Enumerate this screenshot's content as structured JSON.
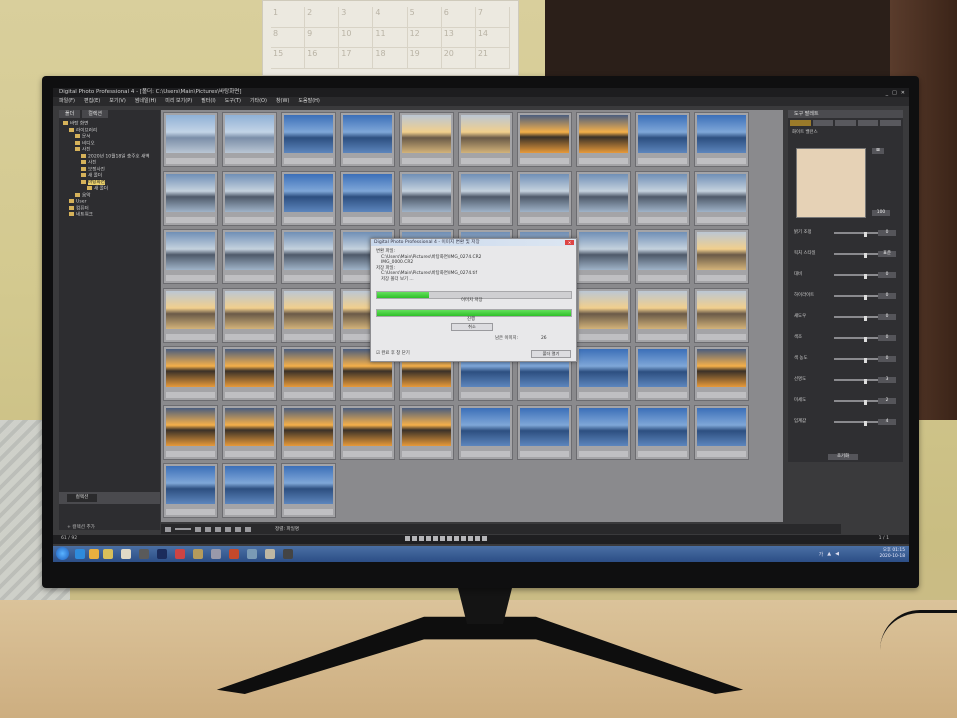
{
  "app": {
    "title": "Digital Photo Professional 4 - [폴더: C:\\Users\\Main\\Pictures\\바탕화면]",
    "window_controls": [
      "_",
      "□",
      "✕"
    ]
  },
  "menu": [
    "파일(F)",
    "편집(E)",
    "보기(V)",
    "썸네일(H)",
    "미리 보기(P)",
    "필터(I)",
    "도구(T)",
    "기타(O)",
    "창(W)",
    "도움말(H)"
  ],
  "left_panel": {
    "tabs": [
      "폴더",
      "컬렉션"
    ],
    "tree": [
      {
        "label": "바탕 화면",
        "depth": 0,
        "selected": false
      },
      {
        "label": "라이브러리",
        "depth": 1,
        "selected": false
      },
      {
        "label": "문서",
        "depth": 2,
        "selected": false
      },
      {
        "label": "비디오",
        "depth": 2,
        "selected": false
      },
      {
        "label": "사진",
        "depth": 2,
        "selected": false
      },
      {
        "label": "2020년 10월18일 충주호 새벽",
        "depth": 3,
        "selected": false
      },
      {
        "label": "사진",
        "depth": 3,
        "selected": false
      },
      {
        "label": "보정사진",
        "depth": 3,
        "selected": false
      },
      {
        "label": "새 폴더",
        "depth": 3,
        "selected": false
      },
      {
        "label": "바탕화면",
        "depth": 3,
        "selected": true
      },
      {
        "label": "새 폴더",
        "depth": 4,
        "selected": false
      },
      {
        "label": "음악",
        "depth": 2,
        "selected": false
      },
      {
        "label": "User",
        "depth": 1,
        "selected": false
      },
      {
        "label": "컴퓨터",
        "depth": 1,
        "selected": false
      },
      {
        "label": "네트워크",
        "depth": 1,
        "selected": false
      }
    ],
    "bottom_tab": "컬렉션",
    "footer": "+ 컬렉션 추가"
  },
  "thumbnails": {
    "rows": [
      [
        "dawn",
        "dawn",
        "blue",
        "blue",
        "gold",
        "gold",
        "sun",
        "sun",
        "blue",
        "blue"
      ],
      [
        "dusk",
        "dusk",
        "blue",
        "blue",
        "dusk",
        "dusk",
        "dusk",
        "dusk",
        "dusk",
        "dusk"
      ],
      [
        "dusk",
        "dusk",
        "dusk",
        "dusk",
        "dusk",
        "dusk",
        "dusk",
        "dusk",
        "dusk",
        "gold"
      ],
      [
        "gold",
        "gold",
        "gold",
        "gold",
        "gold",
        "gold",
        "gold",
        "gold",
        "gold",
        "gold"
      ],
      [
        "sun",
        "sun",
        "sun",
        "sun",
        "sun",
        "blue",
        "blue",
        "blue",
        "blue",
        "sun"
      ],
      [
        "sun",
        "sun",
        "sun",
        "sun",
        "sun",
        "blue",
        "blue",
        "blue",
        "blue",
        "blue"
      ],
      [
        "blue",
        "blue",
        "blue"
      ]
    ]
  },
  "dialog": {
    "title": "Digital Photo Professional 4 - 이미지 변환 및 저장",
    "lines": [
      "변환 파일:",
      "C:\\Users\\Main\\Pictures\\바탕화면\\IMG_0274.CR2",
      "IMG_0000.CR2",
      "저장 파일:",
      "C:\\Users\\Main\\Pictures\\바탕화면\\IMG_0274.tif",
      "저장 폴더 보기 ..."
    ],
    "progress1_label": "이미지 저장",
    "progress1": 0.27,
    "progress2_label": "진행",
    "progress2": 1.0,
    "cancel_label": "취소",
    "remaining_label": "남은 이미지:",
    "remaining_value": "26",
    "checkbox_label": "완료 후 창 닫기",
    "folder_button": "폴더 열기"
  },
  "right_panel": {
    "header": "도구 팔레트",
    "section1": "화이트 밸런스",
    "rows": [
      {
        "label": "밝기 조정",
        "value": "0"
      },
      {
        "label": "픽처 스타일",
        "value": "표준"
      },
      {
        "label": "대비",
        "value": "0"
      },
      {
        "label": "하이라이트",
        "value": "0"
      },
      {
        "label": "섀도우",
        "value": "0"
      },
      {
        "label": "색조",
        "value": "0"
      },
      {
        "label": "색 농도",
        "value": "0"
      },
      {
        "label": "선명도",
        "value": "3"
      },
      {
        "label": "미세도",
        "value": "2"
      },
      {
        "label": "임계값",
        "value": "4"
      }
    ],
    "zoom_value": "100",
    "reset_button": "초기화"
  },
  "toolbar": {
    "label": "정렬: 파일명"
  },
  "status": {
    "count": "61 / 92",
    "selected": "1 / 1"
  },
  "taskbar": {
    "language": "가",
    "time": "오후 01:15",
    "date": "2020-10-18"
  },
  "colors": {
    "taskbar": "#2c4e86",
    "progress": "#2fc02a",
    "selection": "#e9cf6a"
  }
}
